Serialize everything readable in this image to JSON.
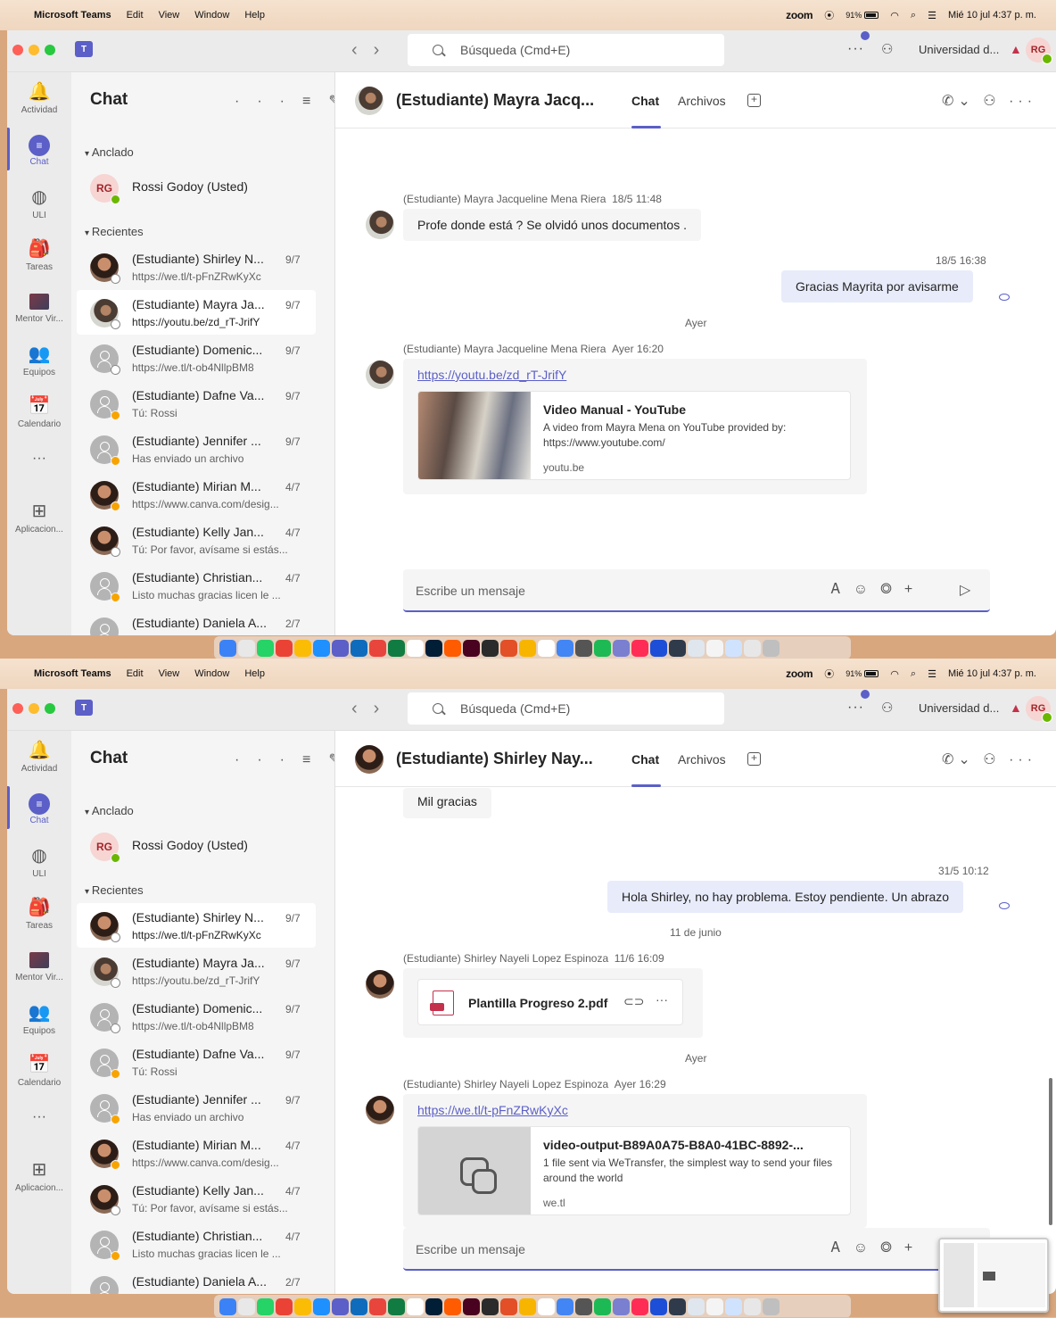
{
  "menubar": {
    "app_name": "Microsoft Teams",
    "items": [
      "Edit",
      "View",
      "Window",
      "Help"
    ],
    "zoom": "zoom",
    "battery": "91%",
    "datetime": "Mié 10 jul 4:37 p. m."
  },
  "titlebar": {
    "search_placeholder": "Búsqueda (Cmd+E)",
    "org_name": "Universidad d...",
    "more": "···",
    "avatar_initials": "RG"
  },
  "rail": [
    {
      "label": "Actividad",
      "icon": "bell-icon",
      "glyph": "🔔"
    },
    {
      "label": "Chat",
      "icon": "chat-icon",
      "glyph": "💬"
    },
    {
      "label": "ULI",
      "icon": "uli-icon",
      "glyph": "◍"
    },
    {
      "label": "Tareas",
      "icon": "backpack-icon",
      "glyph": "🎒"
    },
    {
      "label": "Mentor Vir...",
      "icon": "mentor-icon",
      "glyph": ""
    },
    {
      "label": "Equipos",
      "icon": "teams-icon",
      "glyph": "👥"
    },
    {
      "label": "Calendario",
      "icon": "calendar-icon",
      "glyph": "📅"
    },
    {
      "label": "···",
      "icon": "more-icon",
      "glyph": ""
    },
    {
      "label": "Aplicacion...",
      "icon": "apps-icon",
      "glyph": "⊞"
    }
  ],
  "chatlist": {
    "title": "Chat",
    "pinned_label": "Anclado",
    "recent_label": "Recientes",
    "pinned": {
      "name": "Rossi Godoy (Usted)",
      "initials": "RG"
    },
    "items": [
      {
        "name": "(Estudiante) Shirley N...",
        "date": "9/7",
        "preview": "https://we.tl/t-pFnZRwKyXc"
      },
      {
        "name": "(Estudiante) Mayra Ja...",
        "date": "9/7",
        "preview": "https://youtu.be/zd_rT-JrifY"
      },
      {
        "name": "(Estudiante) Domenic...",
        "date": "9/7",
        "preview": "https://we.tl/t-ob4NllpBM8"
      },
      {
        "name": "(Estudiante) Dafne Va...",
        "date": "9/7",
        "preview": "Tú: Rossi"
      },
      {
        "name": "(Estudiante) Jennifer ...",
        "date": "9/7",
        "preview": "Has enviado un archivo"
      },
      {
        "name": "(Estudiante) Mirian M...",
        "date": "4/7",
        "preview": "https://www.canva.com/desig..."
      },
      {
        "name": "(Estudiante) Kelly Jan...",
        "date": "4/7",
        "preview": "Tú: Por favor, avísame si estás..."
      },
      {
        "name": "(Estudiante) Christian...",
        "date": "4/7",
        "preview": "Listo muchas gracias licen le ..."
      },
      {
        "name": "(Estudiante) Daniela A...",
        "date": "2/7",
        "preview": ""
      }
    ]
  },
  "tabs": {
    "chat": "Chat",
    "files": "Archivos"
  },
  "compose_placeholder": "Escribe un mensaje",
  "s1": {
    "header_title": "(Estudiante) Mayra Jacq...",
    "msg1": {
      "sender": "(Estudiante) Mayra Jacqueline Mena Riera",
      "time": "18/5 11:48",
      "text": "Profe donde está ? Se olvidó unos documentos ."
    },
    "mine1": {
      "time": "18/5 16:38",
      "text": "Gracias Mayrita por avisarme"
    },
    "sep1": "Ayer",
    "msg2": {
      "sender": "(Estudiante) Mayra Jacqueline Mena Riera",
      "time": "Ayer 16:20",
      "link": "https://youtu.be/zd_rT-JrifY",
      "preview_title": "Video Manual - YouTube",
      "preview_desc": "A video from Mayra Mena on YouTube provided by: https://www.youtube.com/",
      "preview_domain": "youtu.be"
    }
  },
  "s2": {
    "header_title": "(Estudiante) Shirley Nay...",
    "top_bubble": "Mil gracias",
    "mine1": {
      "time": "31/5 10:12",
      "text": "Hola Shirley, no hay problema. Estoy pendiente. Un abrazo"
    },
    "sep1": "11 de junio",
    "msg1": {
      "sender": "(Estudiante) Shirley Nayeli Lopez Espinoza",
      "time": "11/6 16:09",
      "file": "Plantilla Progreso 2.pdf"
    },
    "sep2": "Ayer",
    "msg2": {
      "sender": "(Estudiante) Shirley Nayeli Lopez Espinoza",
      "time": "Ayer 16:29",
      "link": "https://we.tl/t-pFnZRwKyXc",
      "preview_title": "video-output-B89A0A75-B8A0-41BC-8892-...",
      "preview_desc": "1 file sent via WeTransfer, the simplest way to send your files around the world",
      "preview_domain": "we.tl"
    }
  },
  "dock_colors": [
    "#3b82f6",
    "#e8e8e8",
    "#25d366",
    "#ea4335",
    "#fbbc05",
    "#1e90ff",
    "#5b5fc7",
    "#0f6cbd",
    "#e8453c",
    "#107c41",
    "#fff",
    "#001e36",
    "#ff5b00",
    "#49021f",
    "#2b2b2b",
    "#e34f26",
    "#f7b500",
    "#ffffff",
    "#4285f4",
    "#555",
    "#1db954",
    "#7a7fd0",
    "#ff2d55",
    "#1d4ed8",
    "#2f3b4a",
    "#dfe6ee",
    "#f4f4f4",
    "#cfe3ff",
    "#e7e7e7",
    "#bfbfbf"
  ]
}
